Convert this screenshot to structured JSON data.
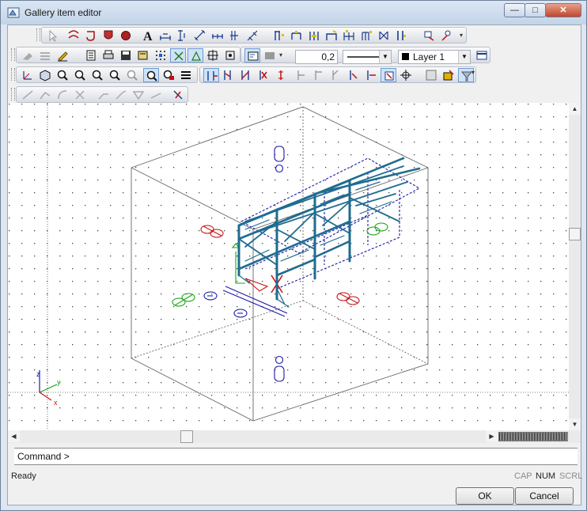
{
  "window": {
    "title": "Gallery item editor",
    "minimize_glyph": "—",
    "maximize_glyph": "□",
    "close_glyph": "✕"
  },
  "toolbar": {
    "line_width_value": "0,2",
    "layer_name": "Layer 1",
    "layer_color": "#000000"
  },
  "canvas": {
    "axis_z": "z",
    "axis_y": "y",
    "axis_x": "x",
    "structure_color": "#1f6c8f",
    "annotation_blue": "#1a1aa8",
    "annotation_red": "#c81414",
    "annotation_green": "#17a517"
  },
  "command": {
    "prompt": "Command >"
  },
  "status": {
    "text": "Ready",
    "cap": "CAP",
    "num": "NUM",
    "scrl": "SCRL"
  },
  "buttons": {
    "ok": "OK",
    "cancel": "Cancel"
  }
}
